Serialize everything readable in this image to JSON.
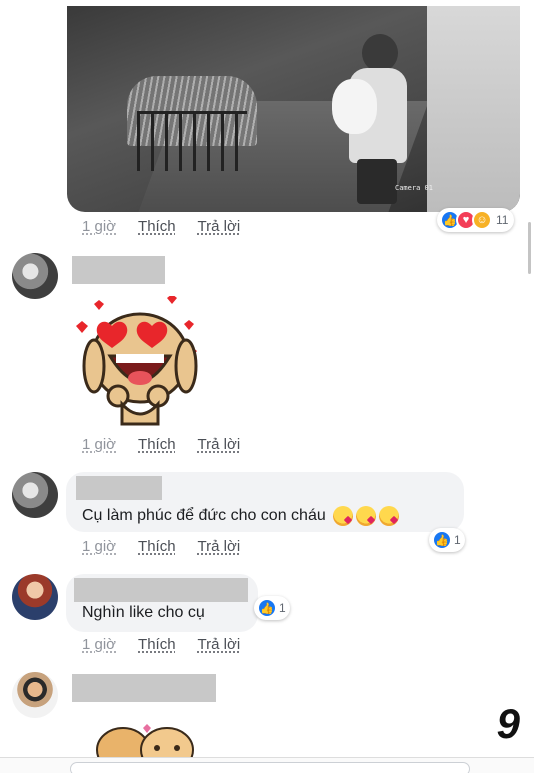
{
  "post": {
    "image_caption": "Camera 01",
    "actions": {
      "time": "1 giờ",
      "like": "Thích",
      "reply": "Trả lời"
    },
    "reactions": {
      "types": [
        "like",
        "love",
        "haha"
      ],
      "count": "11"
    }
  },
  "comments": [
    {
      "actions": {
        "time": "1 giờ",
        "like": "Thích",
        "reply": "Trả lời"
      }
    },
    {
      "text": "Cụ làm phúc để đức cho con cháu",
      "emoji": [
        "kiss-emoji",
        "kiss-emoji",
        "kiss-emoji"
      ],
      "reactions": {
        "types": [
          "like"
        ],
        "count": "1"
      },
      "actions": {
        "time": "1 giờ",
        "like": "Thích",
        "reply": "Trả lời"
      }
    },
    {
      "text": "Nghìn like cho cụ",
      "reactions": {
        "types": [
          "like"
        ],
        "count": "1"
      },
      "actions": {
        "time": "1 giờ",
        "like": "Thích",
        "reply": "Trả lời"
      }
    },
    {}
  ],
  "page_number": "9",
  "colors": {
    "like": "#1877f2",
    "love": "#f33e58",
    "haha": "#f7b125",
    "meta": "#90949c",
    "bubble": "#f2f3f5"
  }
}
